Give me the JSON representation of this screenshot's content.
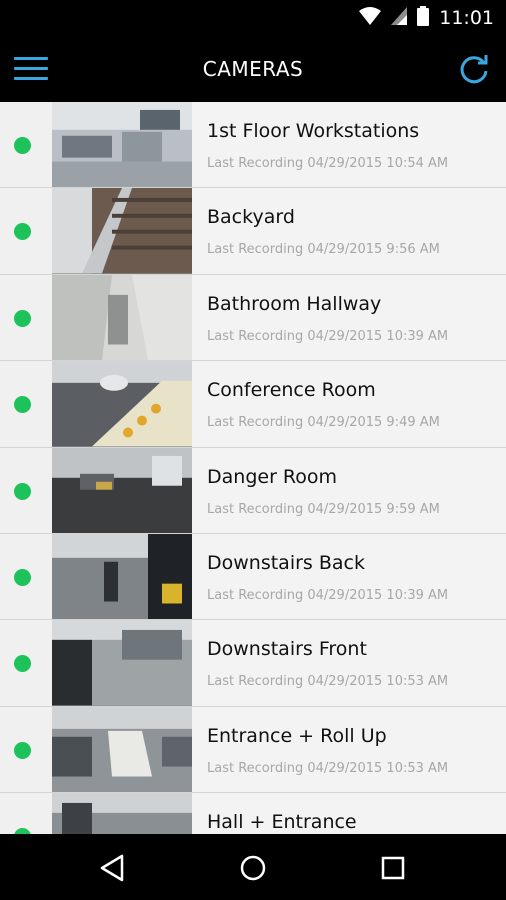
{
  "status": {
    "time": "11:01",
    "icons": [
      "wifi-icon",
      "cell-signal-icon",
      "battery-icon"
    ]
  },
  "app_bar": {
    "title": "CAMERAS",
    "menu_icon": "menu-icon",
    "refresh_icon": "refresh-icon"
  },
  "colors": {
    "accent": "#3ba7e0",
    "online": "#1ec25a",
    "meta_text": "#a7a7a7"
  },
  "cameras": [
    {
      "name": "1st Floor Workstations",
      "last_recording": "Last Recording 04/29/2015 10:54 AM"
    },
    {
      "name": "Backyard",
      "last_recording": "Last Recording 04/29/2015 9:56 AM"
    },
    {
      "name": "Bathroom Hallway",
      "last_recording": "Last Recording 04/29/2015 10:39 AM"
    },
    {
      "name": "Conference Room",
      "last_recording": "Last Recording 04/29/2015 9:49 AM"
    },
    {
      "name": "Danger Room",
      "last_recording": "Last Recording 04/29/2015 9:59 AM"
    },
    {
      "name": "Downstairs Back",
      "last_recording": "Last Recording 04/29/2015 10:39 AM"
    },
    {
      "name": "Downstairs Front",
      "last_recording": "Last Recording 04/29/2015 10:53 AM"
    },
    {
      "name": "Entrance + Roll Up",
      "last_recording": "Last Recording 04/29/2015 10:53 AM"
    },
    {
      "name": "Hall + Entrance",
      "last_recording": ""
    }
  ],
  "nav": {
    "back_icon": "back-icon",
    "home_icon": "home-icon",
    "recents_icon": "recents-icon"
  }
}
